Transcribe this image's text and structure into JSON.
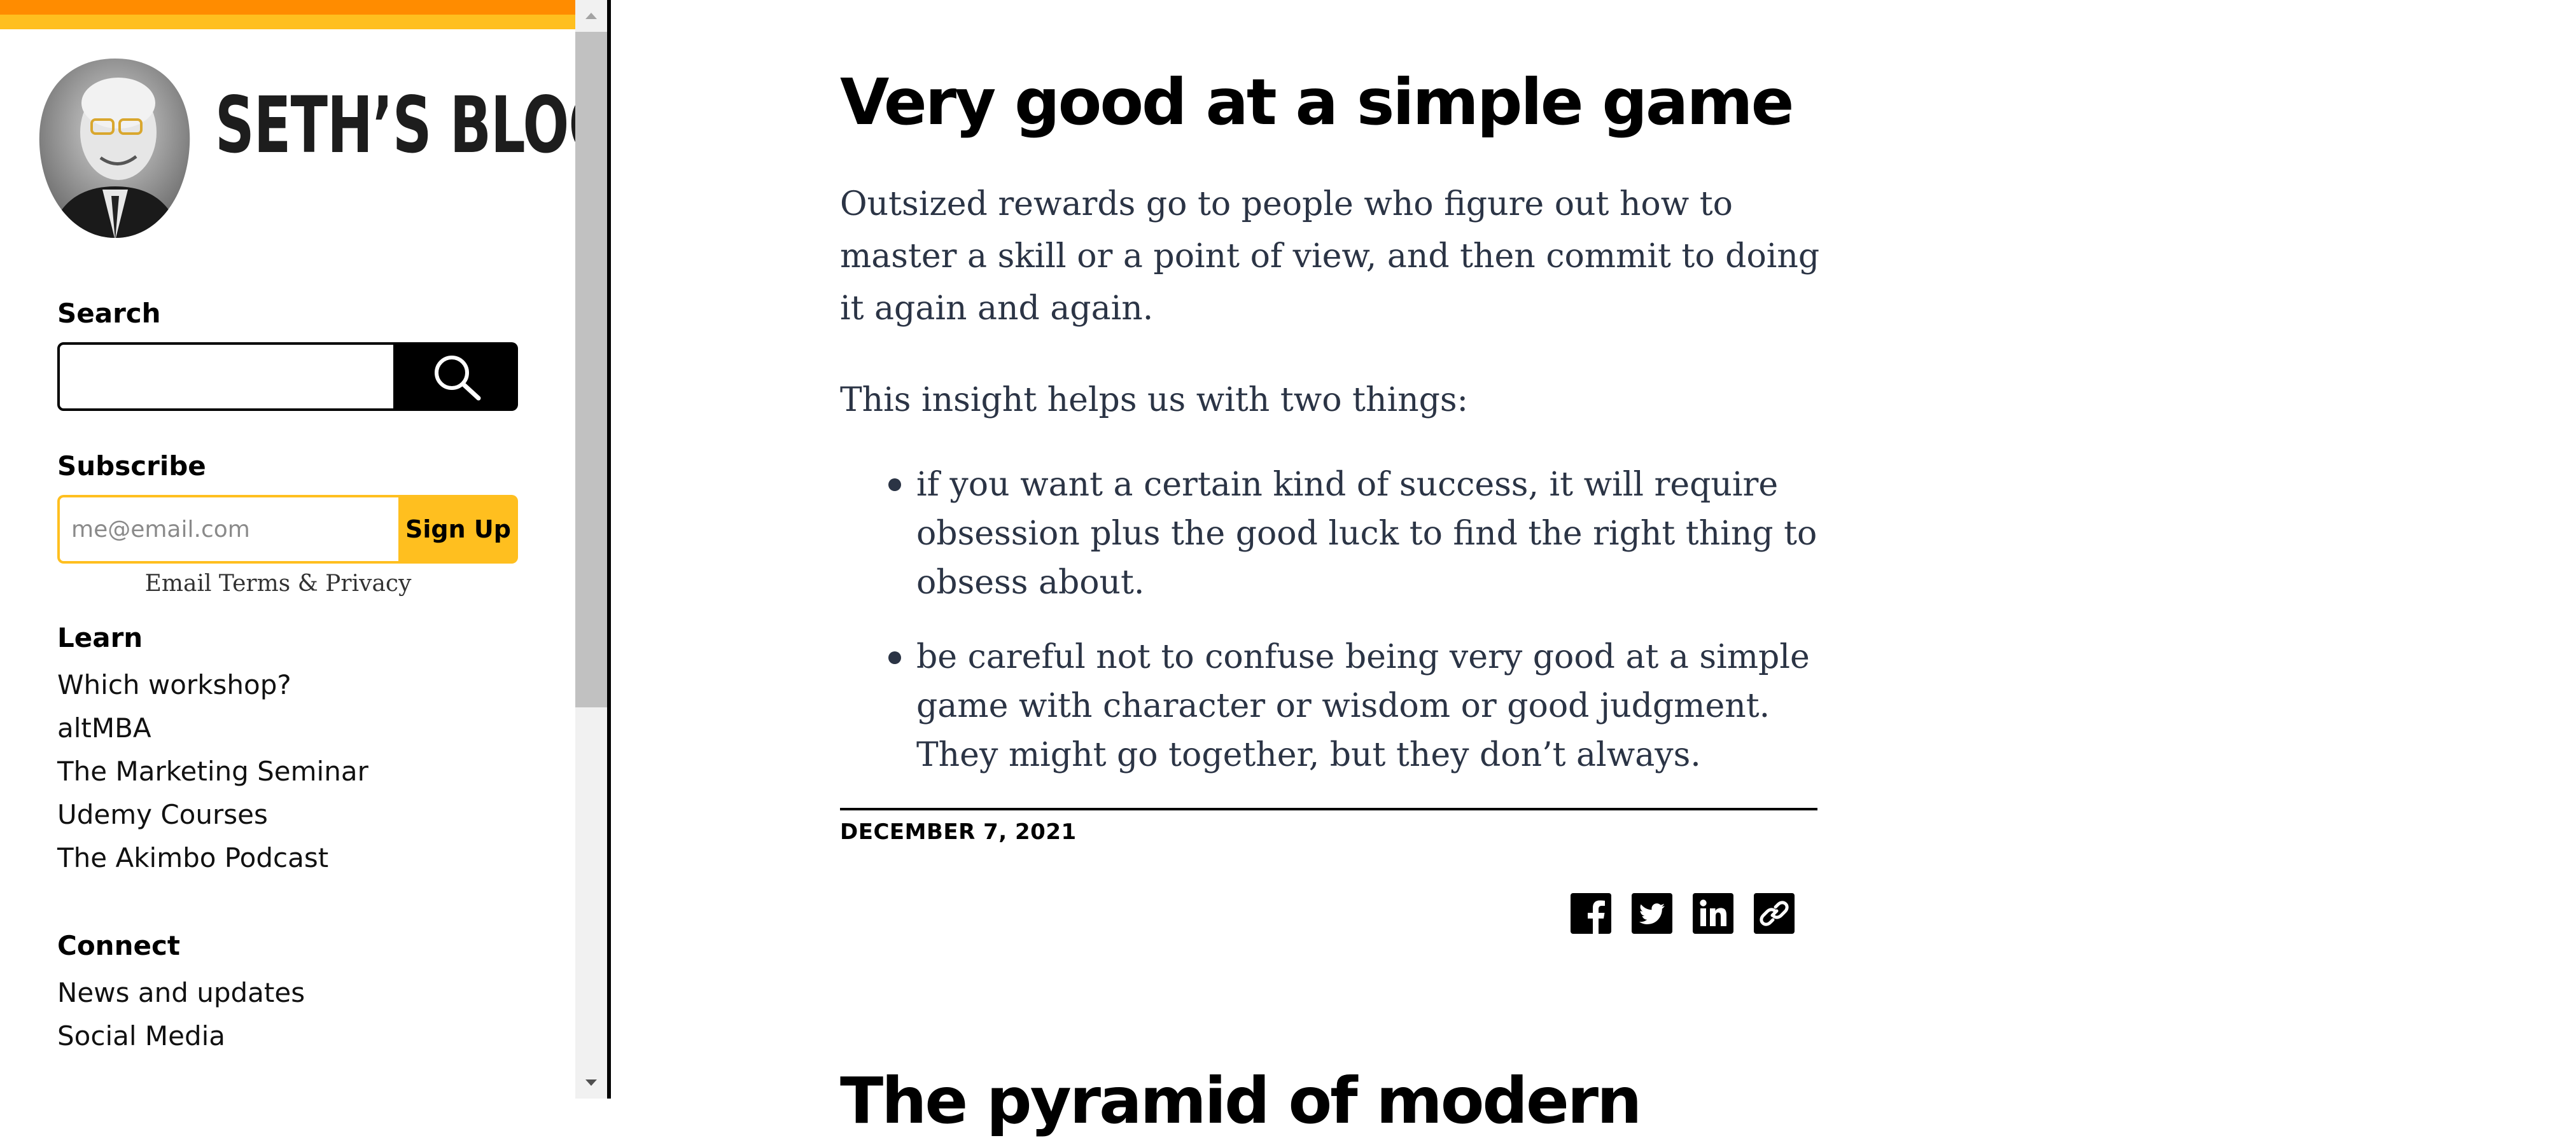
{
  "colors": {
    "stripe_orange": "#ff8c00",
    "stripe_yellow": "#ffbf1f",
    "text_body": "#2b3445",
    "signup_accent": "#ffbf1f"
  },
  "sidebar": {
    "blog_title": "SETH’S BLOG",
    "portrait_icon": "author-portrait",
    "search": {
      "heading": "Search",
      "value": "",
      "button_icon": "search-icon"
    },
    "subscribe": {
      "heading": "Subscribe",
      "placeholder": "me@email.com",
      "button_label": "Sign Up",
      "terms": "Email Terms & Privacy"
    },
    "learn": {
      "heading": "Learn",
      "items": [
        "Which workshop?",
        "altMBA",
        "The Marketing Seminar",
        "Udemy Courses",
        "The Akimbo Podcast"
      ]
    },
    "connect": {
      "heading": "Connect",
      "items": [
        "News and updates",
        "Social Media"
      ]
    }
  },
  "post": {
    "title": "Very good at a simple game",
    "paragraphs": [
      "Outsized rewards go to people who figure out how to master a skill or a point of view, and then commit to doing it again and again.",
      "This insight helps us with two things:"
    ],
    "bullets": [
      "if you want a certain kind of success, it will require obsession plus the good luck to find the right thing to obsess about.",
      "be careful not to confuse being very good at a simple game with character or wisdom or good judgment. They might go together, but they don’t always."
    ],
    "date": "DECEMBER 7, 2021",
    "share_icons": [
      "facebook-icon",
      "twitter-icon",
      "linkedin-icon",
      "link-icon"
    ]
  },
  "next_post": {
    "title": "The pyramid of modern"
  }
}
